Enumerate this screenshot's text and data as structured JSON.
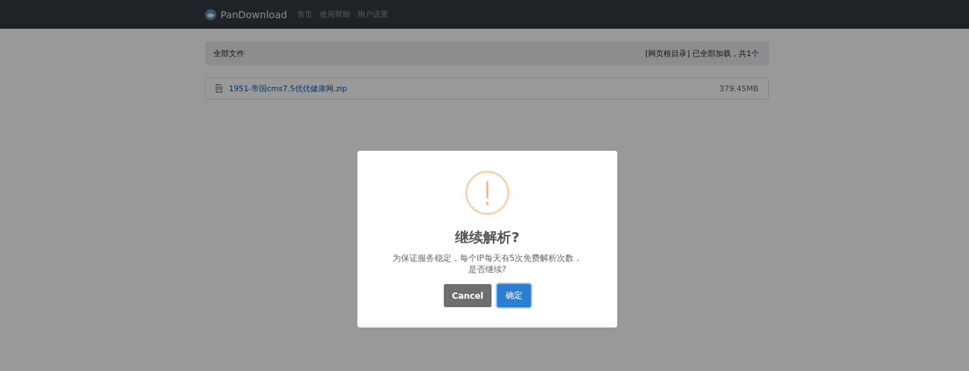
{
  "navbar": {
    "brand": "PanDownload",
    "links": [
      {
        "label": "首页",
        "selected": false
      },
      {
        "label": "使用帮助",
        "selected": false
      },
      {
        "label": "用户设置",
        "selected": false
      }
    ]
  },
  "file_list": {
    "header_left": "全部文件",
    "header_right": "[网页根目录] 已全部加载，共1个",
    "files": [
      {
        "name": "1951-帝国cms7.5优优健康网.zip",
        "size": "379.45MB"
      }
    ]
  },
  "dialog": {
    "title": "继续解析?",
    "message": "为保证服务稳定，每个IP每天有5次免费解析次数，是否继续?",
    "buttons": [
      {
        "label": "Cancel",
        "kind": "cancel"
      },
      {
        "label": "确定",
        "kind": "confirm"
      }
    ]
  }
}
